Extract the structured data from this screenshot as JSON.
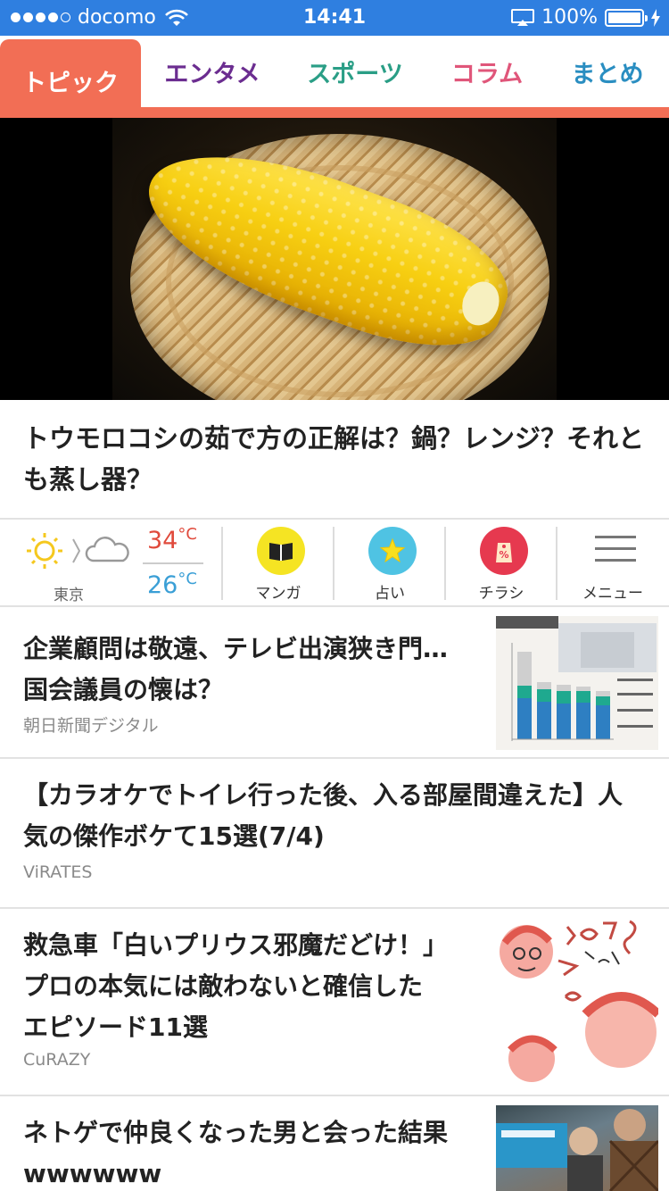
{
  "status_bar": {
    "carrier": "docomo",
    "time": "14:41",
    "battery": "100%",
    "color": "#2f7fe0"
  },
  "tabs": [
    {
      "label": "トピック",
      "color": "#ffffff",
      "active": true
    },
    {
      "label": "エンタメ",
      "color": "#6b2d90",
      "active": false
    },
    {
      "label": "スポーツ",
      "color": "#2a9e86",
      "active": false
    },
    {
      "label": "コラム",
      "color": "#e0567a",
      "active": false
    },
    {
      "label": "まとめ",
      "color": "#2a8ec1",
      "active": false
    }
  ],
  "hero": {
    "image": "corn-on-bamboo-basket",
    "headline": "トウモロコシの茹で方の正解は？鍋？レンジ？それとも蒸し器？"
  },
  "weather": {
    "city": "東京",
    "high": "34",
    "low": "26",
    "unit": "°C",
    "condition": "sunny-then-cloudy"
  },
  "widgets": [
    {
      "label": "マンガ",
      "icon": "book-icon",
      "color": "#f5e423"
    },
    {
      "label": "占い",
      "icon": "star-icon",
      "color": "#4fc3e3"
    },
    {
      "label": "チラシ",
      "icon": "price-tag-icon",
      "color": "#e6394f"
    },
    {
      "label": "メニュー",
      "icon": "hamburger-menu-icon",
      "color": "#777777"
    }
  ],
  "articles": [
    {
      "title_lines": [
        "企業顧問は敬遠、テレビ出演狭き門…",
        "国会議員の懐は？"
      ],
      "source": "朝日新聞デジタル",
      "thumb": "income-chart-thumbnail"
    },
    {
      "title_lines": [
        "【カラオケでトイレ行った後、入る部屋間違えた】人",
        "気の傑作ボケて15選(7/4)"
      ],
      "source": "ViRATES",
      "thumb": ""
    },
    {
      "title_lines": [
        "救急車「白いプリウス邪魔だどけ！」",
        "プロの本気には敵わないと確信した",
        "エピソード11選"
      ],
      "source": "CuRAZY",
      "thumb": "manga-thumbnail"
    },
    {
      "title_lines": [
        "ネトゲで仲良くなった男と会った結果",
        "wwwwww"
      ],
      "source": "",
      "thumb": "people-photo-thumbnail"
    }
  ]
}
